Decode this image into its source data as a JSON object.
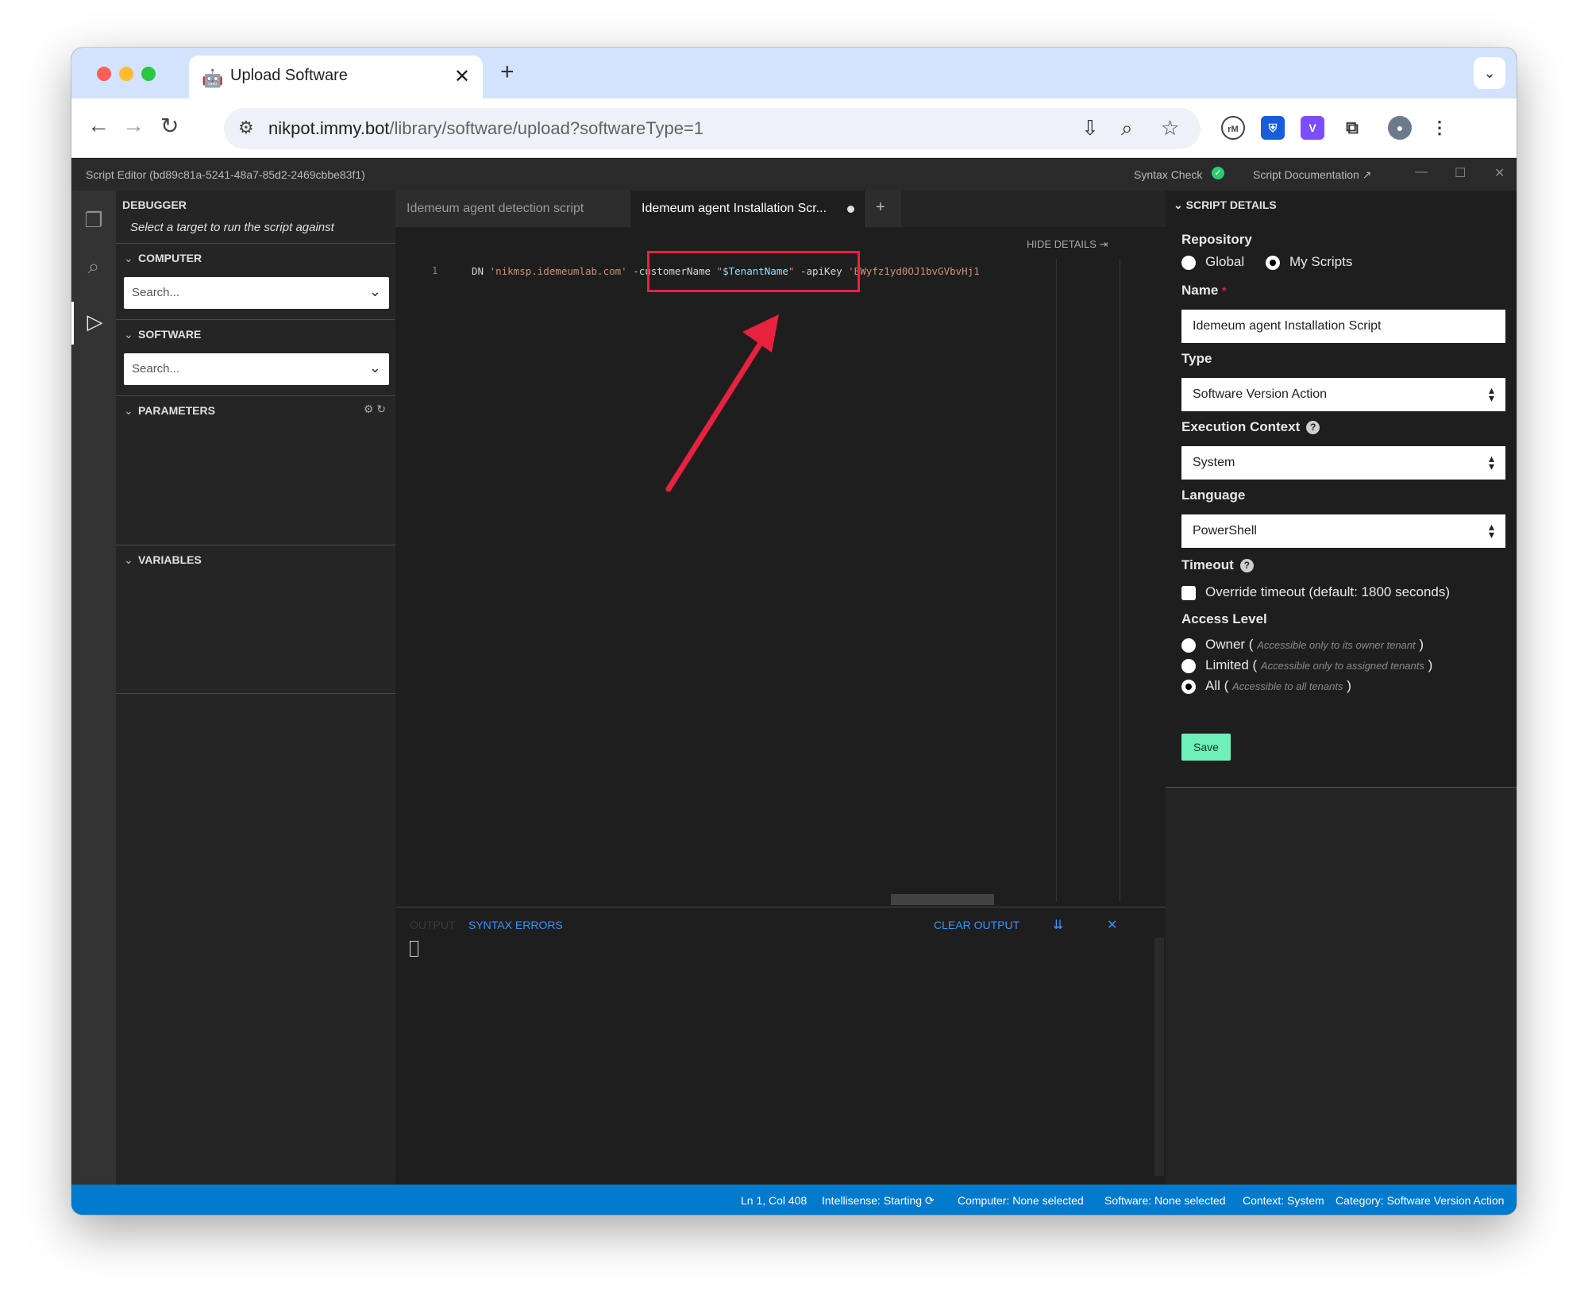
{
  "browser": {
    "tab_title": "Upload Software",
    "url_host": "nikpot.immy.bot",
    "url_path": "/library/software/upload?softwareType=1"
  },
  "app": {
    "title": "Script Editor (bd89c81a-5241-48a7-85d2-2469cbbe83f1)",
    "syntax_check": "Syntax Check",
    "script_documentation": "Script Documentation"
  },
  "debugger": {
    "header": "DEBUGGER",
    "subtitle": "Select a target to run the script against",
    "computer_label": "COMPUTER",
    "computer_placeholder": "Search...",
    "software_label": "SOFTWARE",
    "software_placeholder": "Search...",
    "parameters_label": "PARAMETERS",
    "variables_label": "VARIABLES"
  },
  "editor": {
    "tabs": [
      "Idemeum agent detection script",
      "Idemeum agent Installation Scr..."
    ],
    "add_tab": "+",
    "hide_details": "HIDE DETAILS",
    "line_number": "1",
    "code": {
      "t1": "DN ",
      "s1": "'nikmsp.idemeumlab.com'",
      "t2": " -customerName ",
      "q1": "\"",
      "v1": "$TenantName",
      "q2": "\"",
      "t3": " -apiKey ",
      "s2": "'BWyfz1yd0OJ1bvGVbvHj1"
    }
  },
  "output": {
    "tab_output": "OUTPUT",
    "tab_syntax": "SYNTAX ERRORS",
    "clear": "CLEAR OUTPUT"
  },
  "details": {
    "header": "SCRIPT DETAILS",
    "repository_label": "Repository",
    "repo_global": "Global",
    "repo_mine": "My Scripts",
    "repo_selected": "My Scripts",
    "name_label": "Name",
    "name_value": "Idemeum agent Installation Script",
    "type_label": "Type",
    "type_value": "Software Version Action",
    "exec_label": "Execution Context",
    "exec_value": "System",
    "lang_label": "Language",
    "lang_value": "PowerShell",
    "timeout_label": "Timeout",
    "timeout_override": "Override timeout (default: 1800 seconds)",
    "access_label": "Access Level",
    "access_owner": "Owner",
    "access_owner_hint": "Accessible only to its owner tenant",
    "access_limited": "Limited",
    "access_limited_hint": "Accessible only to assigned tenants",
    "access_all": "All",
    "access_all_hint": "Accessible to all tenants",
    "access_selected": "All",
    "save": "Save"
  },
  "status": {
    "position": "Ln 1, Col 408",
    "intellisense": "Intellisense: Starting",
    "computer": "Computer: None selected",
    "software": "Software: None selected",
    "context": "Context: System",
    "category": "Category: Software Version Action"
  },
  "colors": {
    "accent": "#007acc",
    "highlight_box": "#e8213f",
    "save_button": "#6ef0b8"
  }
}
